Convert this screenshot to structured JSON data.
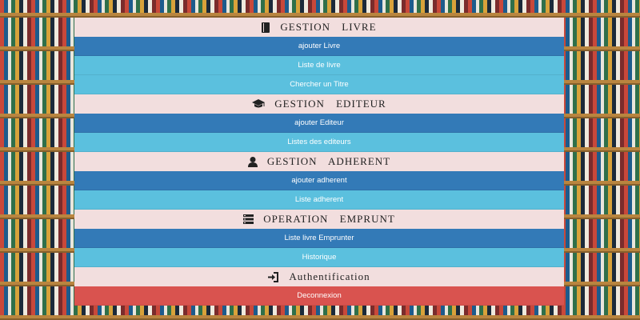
{
  "sections": [
    {
      "title": "GESTION LIVRE",
      "icon": "book-icon",
      "buttons": [
        {
          "label": "ajouter Livre",
          "style": "primary"
        },
        {
          "label": "Liste de livre",
          "style": "info"
        },
        {
          "label": "Chercher un Titre",
          "style": "info"
        }
      ]
    },
    {
      "title": "GESTION EDITEUR",
      "icon": "graduation-cap-icon",
      "buttons": [
        {
          "label": "ajouter Editeur",
          "style": "primary"
        },
        {
          "label": "Listes des editeurs",
          "style": "info"
        }
      ]
    },
    {
      "title": "GESTION ADHERENT",
      "icon": "user-icon",
      "buttons": [
        {
          "label": "ajouter adherent",
          "style": "primary"
        },
        {
          "label": "Liste adherent",
          "style": "info"
        }
      ]
    },
    {
      "title": "OPERATION EMPRUNT",
      "icon": "list-icon",
      "buttons": [
        {
          "label": "Liste livre Emprunter",
          "style": "primary"
        },
        {
          "label": "Historique",
          "style": "info"
        }
      ]
    },
    {
      "title": "Authentification",
      "icon": "log-in-icon",
      "buttons": [
        {
          "label": "Deconnexion",
          "style": "danger"
        }
      ]
    }
  ],
  "colors": {
    "header_bg": "#f2dede",
    "primary": "#337ab7",
    "info": "#5bc0de",
    "danger": "#d9534f"
  }
}
